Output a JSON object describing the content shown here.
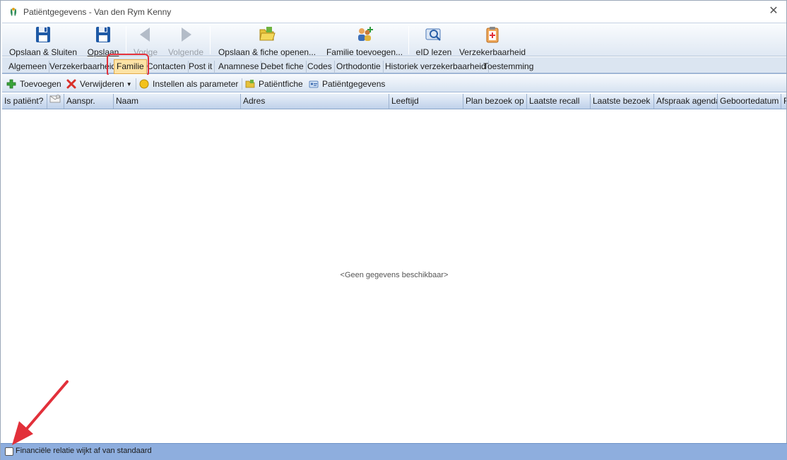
{
  "window": {
    "title": "Patiëntgegevens - Van den Rym Kenny"
  },
  "toolbar": {
    "save_close": "Opslaan & Sluiten",
    "save": "Opslaan",
    "previous": "Vorige",
    "next": "Volgende",
    "save_open_file": "Opslaan & fiche openen...",
    "add_family": "Familie toevoegen...",
    "eid_read": "eID lezen",
    "insurance": "Verzekerbaarheid"
  },
  "tabs": [
    "Algemeen",
    "Verzekerbaarheid",
    "Familie",
    "Contacten",
    "Post it",
    "Anamnese",
    "Debet fiche",
    "Codes",
    "Orthodontie",
    "Historiek verzekerbaarheid",
    "Toestemming"
  ],
  "active_tab": "Familie",
  "actions": {
    "add": "Toevoegen",
    "remove": "Verwijderen",
    "set_parameter": "Instellen als parameter",
    "patient_file": "Patiëntfiche",
    "patient_data": "Patiëntgegevens"
  },
  "grid": {
    "columns": [
      "Is patiënt?",
      "",
      "Aanspr.",
      "Naam",
      "Adres",
      "Leeftijd",
      "Plan bezoek op",
      "Laatste recall",
      "Laatste bezoek",
      "Afspraak agenda",
      "Geboortedatum",
      "F"
    ],
    "empty_message": "<Geen gegevens beschikbaar>"
  },
  "footer": {
    "financial_label": "Financiële relatie wijkt af van standaard",
    "financial_checked": false
  },
  "colors": {
    "accent": "#e2303a",
    "active_tab_bg": "#fde3a5",
    "footer_bg": "#8eaede"
  }
}
